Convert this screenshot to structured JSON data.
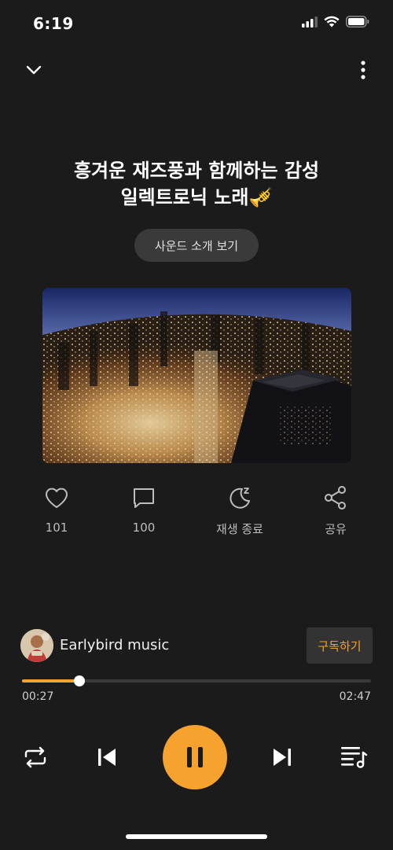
{
  "status": {
    "time": "6:19"
  },
  "header": {
    "collapse_icon": "chevron-down-icon",
    "more_icon": "more-vertical-icon"
  },
  "title": {
    "line1": "흥겨운 재즈풍과 함께하는 감성",
    "line2": "일렉트로닉 노래🎺"
  },
  "intro_button": {
    "label": "사운드 소개 보기"
  },
  "actions": {
    "like": {
      "label": "101",
      "icon": "heart-icon"
    },
    "comment": {
      "label": "100",
      "icon": "comment-icon"
    },
    "sleep": {
      "label": "재생 종료",
      "icon": "moon-sleep-icon"
    },
    "share": {
      "label": "공유",
      "icon": "share-icon"
    }
  },
  "channel": {
    "name": "Earlybird music",
    "subscribe_label": "구독하기"
  },
  "player": {
    "elapsed": "00:27",
    "total": "02:47",
    "progress": 0.165
  },
  "colors": {
    "accent": "#f5a22e",
    "background": "#1b1b1b"
  }
}
